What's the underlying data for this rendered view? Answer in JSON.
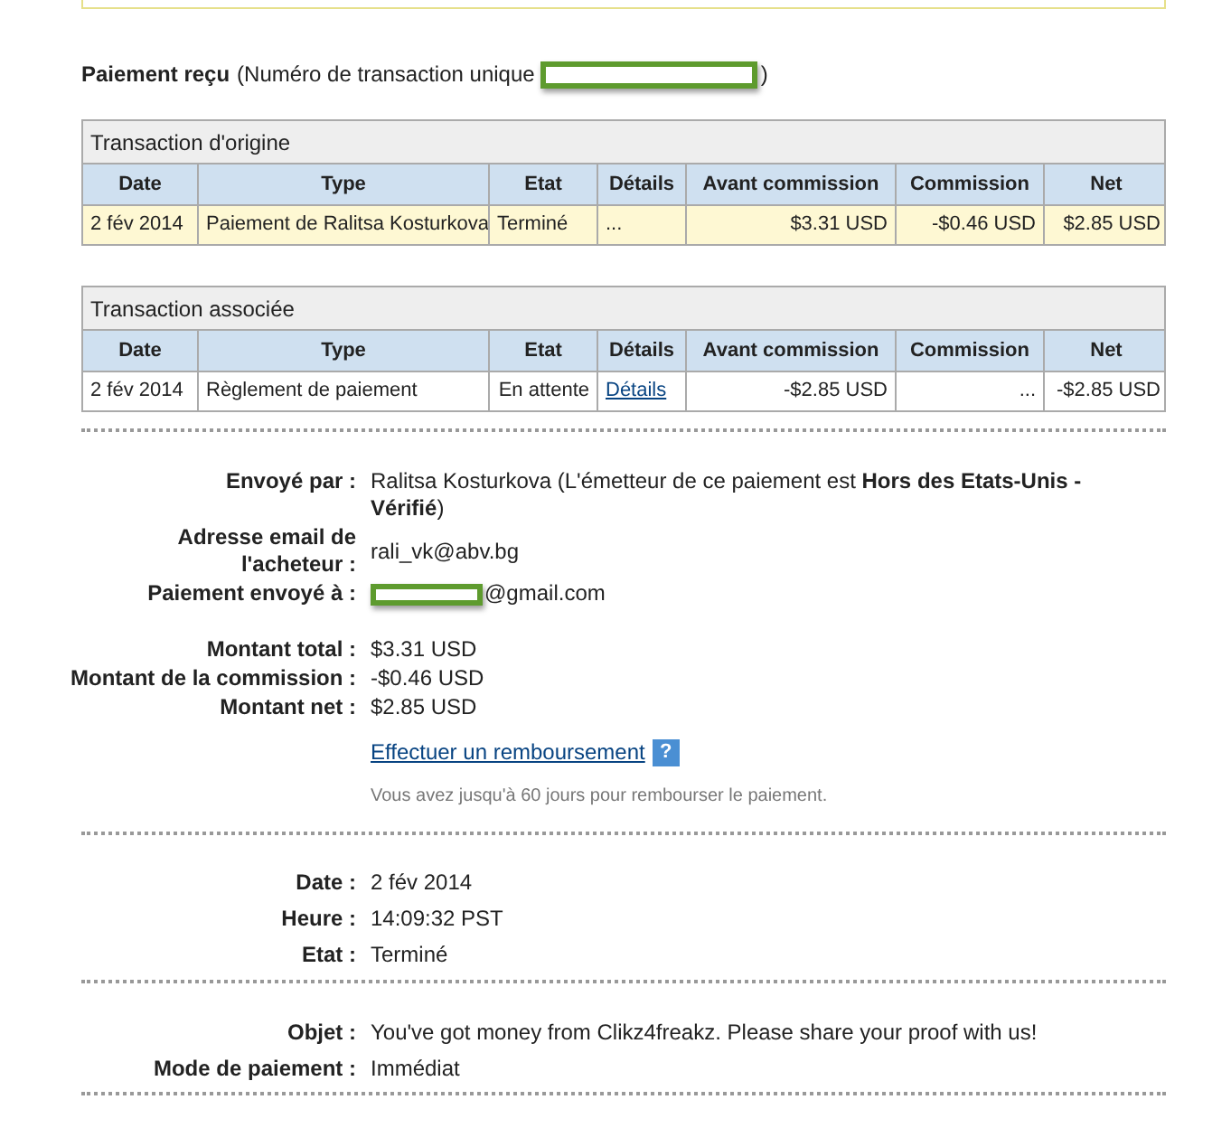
{
  "heading": {
    "title": "Paiement reçu",
    "subtitle": "(Numéro de transaction unique",
    "redacted": true,
    "closing": ")"
  },
  "tables": [
    {
      "caption": "Transaction d'origine",
      "columns": [
        "Date",
        "Type",
        "Etat",
        "Détails",
        "Avant commission",
        "Commission",
        "Net"
      ],
      "rows": [
        {
          "highlighted": true,
          "cells": [
            {
              "text": "2 fév 2014"
            },
            {
              "text": "Paiement de Ralitsa Kosturkova"
            },
            {
              "text": "Terminé"
            },
            {
              "text": "..."
            },
            {
              "text": "$3.31 USD"
            },
            {
              "text": "-$0.46 USD"
            },
            {
              "text": "$2.85 USD"
            }
          ]
        }
      ]
    },
    {
      "caption": "Transaction associée",
      "columns": [
        "Date",
        "Type",
        "Etat",
        "Détails",
        "Avant commission",
        "Commission",
        "Net"
      ],
      "rows": [
        {
          "highlighted": false,
          "cells": [
            {
              "text": "2 fév 2014"
            },
            {
              "text": "Règlement de paiement"
            },
            {
              "text": "En attente"
            },
            {
              "text": "Détails",
              "kind": "link"
            },
            {
              "text": "-$2.85 USD"
            },
            {
              "text": "..."
            },
            {
              "text": "-$2.85 USD"
            }
          ]
        }
      ]
    }
  ],
  "sections": [
    {
      "fields": [
        {
          "label": "Envoyé par :",
          "value": "Ralitsa Kosturkova (L'émetteur de ce paiement est **Hors des Etats-Unis - Vérifié**)"
        },
        {
          "label": "Adresse email de l'acheteur :",
          "value": "rali_vk@abv.bg"
        },
        {
          "label": "Paiement envoyé à :",
          "value": "@gmail.com",
          "redacted": true
        },
        {
          "label": "Montant total :",
          "value": "$3.31 USD",
          "spaced": true
        },
        {
          "label": "Montant de la commission :",
          "value": "-$0.46 USD"
        },
        {
          "label": "Montant net :",
          "value": "$2.85 USD"
        }
      ],
      "link": "Effectuer un remboursement",
      "help": "?",
      "note": "Vous avez jusqu'à 60 jours pour rembourser le paiement."
    },
    {
      "fields": [
        {
          "label": "Date :",
          "value": "2 fév 2014"
        },
        {
          "label": "Heure :",
          "value": "14:09:32 PST"
        },
        {
          "label": "Etat :",
          "value": "Terminé"
        }
      ]
    },
    {
      "fields": [
        {
          "label": "Objet :",
          "value": "You've got money from Clikz4freakz. Please share your proof with us!"
        },
        {
          "label": "Mode de paiement :",
          "value": "Immédiat"
        }
      ]
    }
  ]
}
